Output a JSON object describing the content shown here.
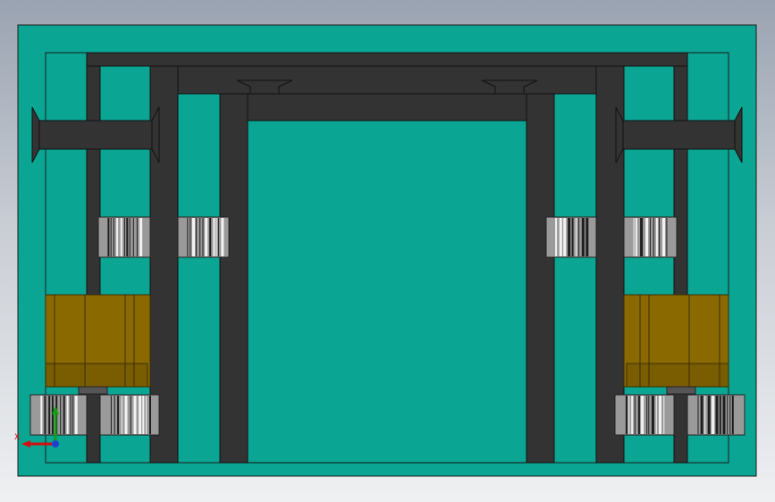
{
  "viewport": {
    "background_top": "#9aa3b1",
    "background_bottom": "#eef0f2"
  },
  "colors": {
    "plate": "#0aa593",
    "frame": "#333333",
    "gear_face": "#8f8f8f",
    "motor": "#8a6a00",
    "outline": "#1a1a1a"
  },
  "triad": {
    "x_label": "X",
    "x_color": "#d01010",
    "y_color": "#10a010",
    "z_color": "#2040d0"
  }
}
